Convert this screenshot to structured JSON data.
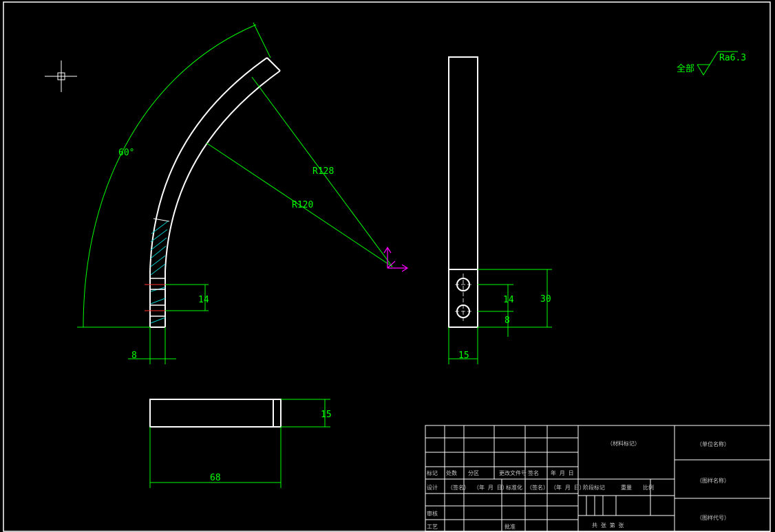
{
  "colors": {
    "background": "#000000",
    "geometry": "#ffffff",
    "dimension": "#00ff00",
    "ucs": "#ff00ff",
    "centerline": "#ff3030",
    "hatch": "#00c8c8"
  },
  "roughness": {
    "prefix": "全部",
    "value": "Ra6.3"
  },
  "dimensions": {
    "angle": "60°",
    "r128": "R128",
    "r120": "R120",
    "hole_spacing_front": "14",
    "thickness": "8",
    "hole_spacing_side": "14",
    "edge_offset_side": "8",
    "height_side": "30",
    "width_side": "15",
    "height_top": "15",
    "length_top": "68"
  },
  "title_block": {
    "material_mark": "（材料标记）",
    "unit_name": "（单位名称）",
    "drawing_name": "（图样名称）",
    "drawing_code": "（图样代号）",
    "mark": "标记",
    "count": "处数",
    "zone": "分区",
    "change_doc": "更改文件号",
    "signature": "签名",
    "date": "年 月 日",
    "design": "设计",
    "sign_paren": "（签名）",
    "date_paren": "（年 月 日）",
    "standardize": "标准化",
    "stage_mark": "阶段标记",
    "weight": "重量",
    "scale": "比例",
    "review": "审核",
    "process": "工艺",
    "approve": "批准",
    "sheet_info": "共 张 第 张"
  }
}
